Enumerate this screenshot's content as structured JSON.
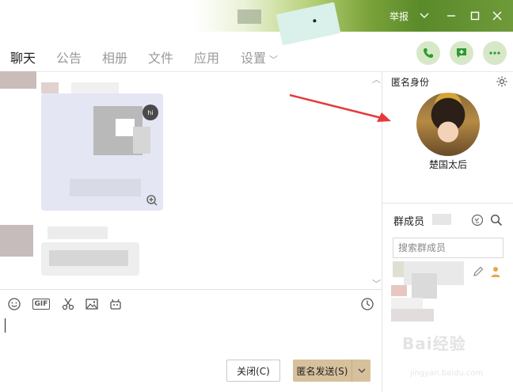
{
  "titlebar": {
    "report_label": "举报",
    "dropdown_icon": "chevron-down-icon",
    "controls": [
      "minimize-icon",
      "maximize-icon",
      "close-icon"
    ]
  },
  "nav": {
    "tabs": [
      {
        "label": "聊天",
        "active": true
      },
      {
        "label": "公告",
        "active": false
      },
      {
        "label": "相册",
        "active": false
      },
      {
        "label": "文件",
        "active": false
      },
      {
        "label": "应用",
        "active": false
      },
      {
        "label": "设置",
        "active": false
      }
    ],
    "actions": [
      "phone-icon",
      "add-message-icon",
      "more-icon"
    ]
  },
  "toolbar": {
    "gif_label": "GIF",
    "icons": [
      "emoji-icon",
      "gif-icon",
      "scissors-icon",
      "image-icon",
      "robot-icon",
      "history-clock-icon"
    ]
  },
  "composer": {
    "close_label": "关闭(C)",
    "send_label": "匿名发送(S)"
  },
  "anonymous": {
    "title": "匿名身份",
    "name": "楚国太后"
  },
  "members": {
    "title": "群成员",
    "search_placeholder": "搜索群成员"
  },
  "watermark": {
    "brand": "Bai经验",
    "url": "jingyan.baidu.com"
  },
  "colors": {
    "accent_green": "#3aa63a",
    "send_button": "#d7c19c",
    "action_circle": "#d7e8c8"
  }
}
